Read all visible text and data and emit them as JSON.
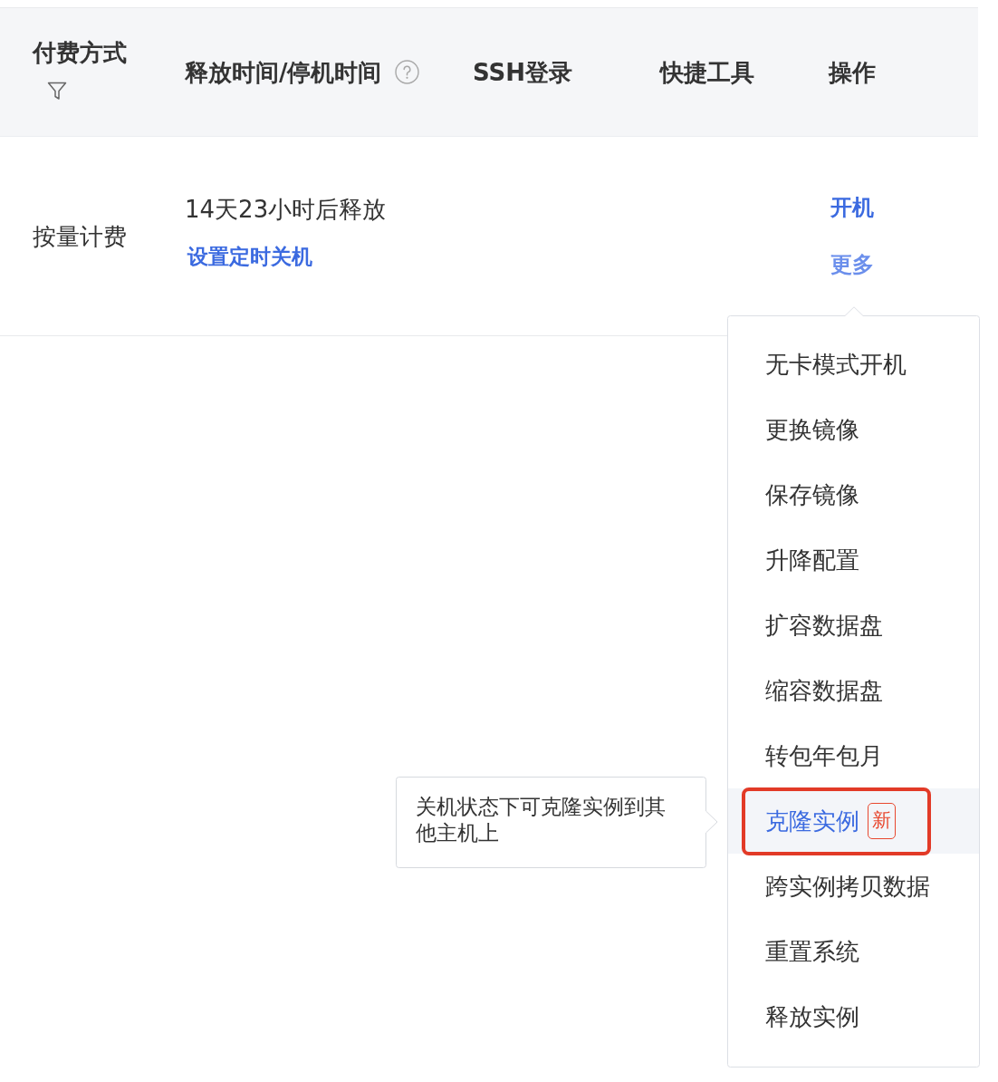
{
  "table": {
    "columns": [
      {
        "label": "付费方式",
        "filterable": true,
        "help_tip": false
      },
      {
        "label": "释放时间/停机时间",
        "filterable": false,
        "help_tip": true
      },
      {
        "label": "SSH登录",
        "filterable": false,
        "help_tip": false
      },
      {
        "label": "快捷工具",
        "filterable": false,
        "help_tip": false
      },
      {
        "label": "操作",
        "filterable": false,
        "help_tip": false
      }
    ],
    "rows": [
      {
        "billing": "按量计费",
        "release_time": "14天23小时后释放",
        "release_link": "设置定时关机",
        "actions": [
          {
            "label": "开机",
            "expanded": false
          },
          {
            "label": "更多",
            "expanded": true
          }
        ]
      }
    ]
  },
  "menu": {
    "items": [
      {
        "label": "无卡模式开机",
        "selected": false,
        "outlined": false
      },
      {
        "label": "更换镜像",
        "selected": false,
        "outlined": false
      },
      {
        "label": "保存镜像",
        "selected": false,
        "outlined": false
      },
      {
        "label": "升降配置",
        "selected": false,
        "outlined": false
      },
      {
        "label": "扩容数据盘",
        "selected": false,
        "outlined": false
      },
      {
        "label": "缩容数据盘",
        "selected": false,
        "outlined": false
      },
      {
        "label": "转包年包月",
        "selected": false,
        "outlined": false
      },
      {
        "label": "克隆实例",
        "selected": true,
        "outlined": true,
        "badge": "新"
      },
      {
        "label": "跨实例拷贝数据",
        "selected": false,
        "outlined": false
      },
      {
        "label": "重置系统",
        "selected": false,
        "outlined": false
      },
      {
        "label": "释放实例",
        "selected": false,
        "outlined": false
      }
    ]
  },
  "tooltip": {
    "text": "关机状态下可克隆实例到其他主机上"
  }
}
